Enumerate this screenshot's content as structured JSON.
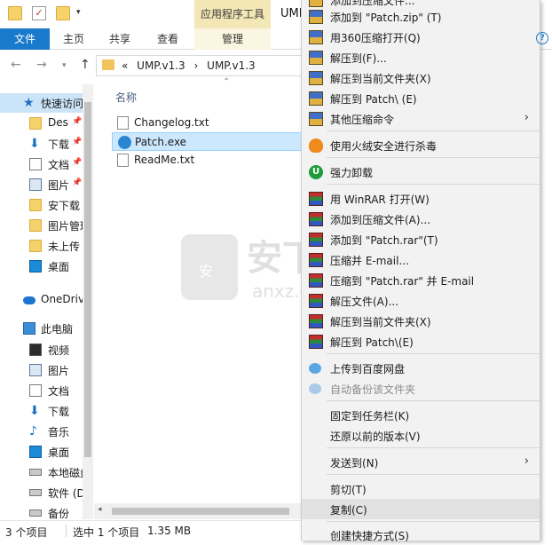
{
  "window": {
    "contextual_tab_title": "应用程序工具",
    "title_fragment": "UMP"
  },
  "ribbon": {
    "tabs": [
      "文件",
      "主页",
      "共享",
      "查看",
      "管理"
    ],
    "help_icon": "help-circle-icon"
  },
  "address": {
    "overflow": "«",
    "path": [
      "UMP.v1.3",
      "UMP.v1.3"
    ],
    "separator": "›"
  },
  "nav": {
    "quick_access": "快速访问",
    "items": [
      {
        "label": "Des",
        "icon": "folder-icon",
        "pinned": true
      },
      {
        "label": "下载",
        "icon": "download-icon",
        "pinned": true
      },
      {
        "label": "文档",
        "icon": "document-icon",
        "pinned": true
      },
      {
        "label": "图片",
        "icon": "pictures-icon",
        "pinned": true
      },
      {
        "label": "安下载",
        "icon": "folder-icon",
        "pinned": false
      },
      {
        "label": "图片管理",
        "icon": "folder-icon",
        "pinned": false
      },
      {
        "label": "未上传",
        "icon": "folder-icon",
        "pinned": false
      },
      {
        "label": "桌面",
        "icon": "desktop-icon",
        "pinned": false
      }
    ],
    "onedrive": "OneDrive",
    "this_pc": "此电脑",
    "pc_items": [
      {
        "label": "视频",
        "icon": "video-icon"
      },
      {
        "label": "图片",
        "icon": "pictures-icon"
      },
      {
        "label": "文档",
        "icon": "document-icon"
      },
      {
        "label": "下载",
        "icon": "download-icon"
      },
      {
        "label": "音乐",
        "icon": "music-icon"
      },
      {
        "label": "桌面",
        "icon": "desktop-icon"
      },
      {
        "label": "本地磁盘",
        "icon": "drive-icon"
      },
      {
        "label": "软件 (D",
        "icon": "drive-icon"
      },
      {
        "label": "备份",
        "icon": "drive-icon"
      }
    ]
  },
  "files": {
    "column_name": "名称",
    "rows": [
      {
        "name": "Changelog.txt",
        "type": "txt",
        "selected": false
      },
      {
        "name": "Patch.exe",
        "type": "exe",
        "selected": true
      },
      {
        "name": "ReadMe.txt",
        "type": "txt",
        "selected": false
      }
    ]
  },
  "status": {
    "count": "3 个项目",
    "selected": "选中 1 个项目",
    "size": "1.35 MB"
  },
  "watermark": {
    "big": "安下",
    "small": "anxz.com",
    "badge": "安"
  },
  "context_menu": {
    "items": [
      {
        "label": "添加到压缩文件...",
        "icon": "zip-icon"
      },
      {
        "label": "添加到 \"Patch.zip\" (T)",
        "icon": "zip-icon"
      },
      {
        "label": "用360压缩打开(Q)",
        "icon": "zip-icon"
      },
      {
        "label": "解压到(F)...",
        "icon": "zip-icon"
      },
      {
        "label": "解压到当前文件夹(X)",
        "icon": "zip-icon"
      },
      {
        "label": "解压到 Patch\\ (E)",
        "icon": "zip-icon"
      },
      {
        "label": "其他压缩命令",
        "icon": "zip-icon",
        "submenu": true
      },
      {
        "label": "使用火绒安全进行杀毒",
        "icon": "fire-shield-icon"
      },
      {
        "label": "强力卸载",
        "icon": "uninstall-icon"
      },
      {
        "label": "用 WinRAR 打开(W)",
        "icon": "winrar-icon"
      },
      {
        "label": "添加到压缩文件(A)...",
        "icon": "winrar-icon"
      },
      {
        "label": "添加到 \"Patch.rar\"(T)",
        "icon": "winrar-icon"
      },
      {
        "label": "压缩并 E-mail...",
        "icon": "winrar-icon"
      },
      {
        "label": "压缩到 \"Patch.rar\" 并 E-mail",
        "icon": "winrar-icon"
      },
      {
        "label": "解压文件(A)...",
        "icon": "winrar-icon"
      },
      {
        "label": "解压到当前文件夹(X)",
        "icon": "winrar-icon"
      },
      {
        "label": "解压到 Patch\\(E)",
        "icon": "winrar-icon"
      },
      {
        "label": "上传到百度网盘",
        "icon": "baidu-cloud-icon"
      },
      {
        "label": "自动备份该文件夹",
        "icon": "baidu-cloud-icon",
        "disabled": true
      },
      {
        "label": "固定到任务栏(K)",
        "icon": ""
      },
      {
        "label": "还原以前的版本(V)",
        "icon": ""
      },
      {
        "label": "发送到(N)",
        "icon": "",
        "submenu": true
      },
      {
        "label": "剪切(T)",
        "icon": ""
      },
      {
        "label": "复制(C)",
        "icon": "",
        "hover": true
      },
      {
        "label": "创建快捷方式(S)",
        "icon": ""
      }
    ]
  }
}
